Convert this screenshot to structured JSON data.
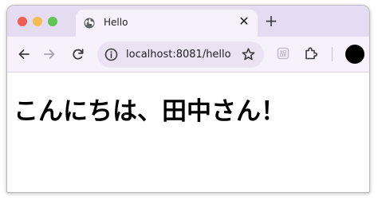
{
  "tab": {
    "title": "Hello",
    "close_glyph": "✕",
    "favicon": "globe-icon"
  },
  "tabstrip": {
    "new_tab_glyph": "+"
  },
  "toolbar": {
    "url": "localhost:8081/hello",
    "icons": [
      "back-arrow-icon",
      "forward-arrow-icon",
      "reload-icon",
      "info-icon",
      "star-icon",
      "extension-icon",
      "puzzle-icon"
    ]
  },
  "page": {
    "heading": "こんにちは、田中さん！"
  },
  "colors": {
    "tabstrip_bg": "#e6dcf2",
    "toolbar_bg": "#f7f1fb",
    "omnibox_bg": "#ebe2f3",
    "close": "#ee5f57",
    "minimize": "#f5bd4f",
    "maximize": "#5fc454",
    "avatar": "#000000"
  }
}
